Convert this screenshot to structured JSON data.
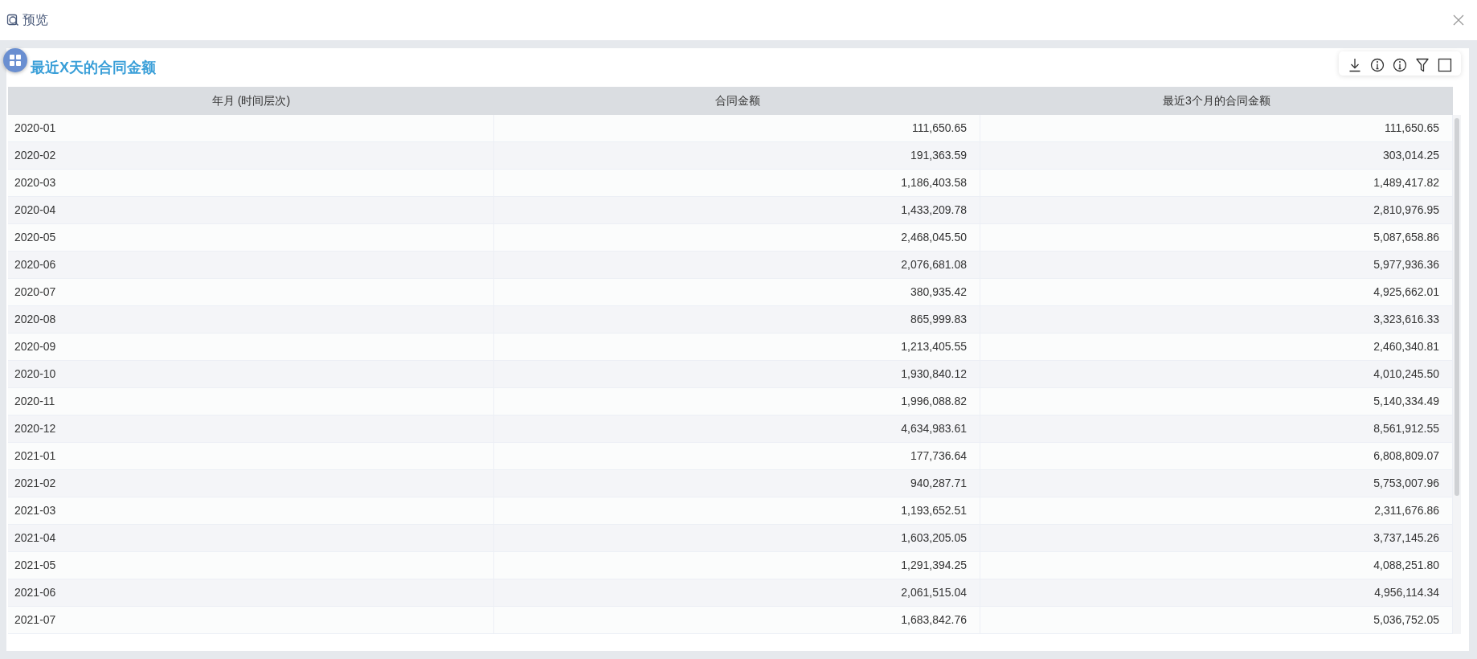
{
  "window": {
    "title": "预览"
  },
  "widget": {
    "title": "最近X天的合同金额"
  },
  "table": {
    "columns": [
      "年月 (时间层次)",
      "合同金额",
      "最近3个月的合同金额"
    ],
    "rows": [
      [
        "2020-01",
        "111,650.65",
        "111,650.65"
      ],
      [
        "2020-02",
        "191,363.59",
        "303,014.25"
      ],
      [
        "2020-03",
        "1,186,403.58",
        "1,489,417.82"
      ],
      [
        "2020-04",
        "1,433,209.78",
        "2,810,976.95"
      ],
      [
        "2020-05",
        "2,468,045.50",
        "5,087,658.86"
      ],
      [
        "2020-06",
        "2,076,681.08",
        "5,977,936.36"
      ],
      [
        "2020-07",
        "380,935.42",
        "4,925,662.01"
      ],
      [
        "2020-08",
        "865,999.83",
        "3,323,616.33"
      ],
      [
        "2020-09",
        "1,213,405.55",
        "2,460,340.81"
      ],
      [
        "2020-10",
        "1,930,840.12",
        "4,010,245.50"
      ],
      [
        "2020-11",
        "1,996,088.82",
        "5,140,334.49"
      ],
      [
        "2020-12",
        "4,634,983.61",
        "8,561,912.55"
      ],
      [
        "2021-01",
        "177,736.64",
        "6,808,809.07"
      ],
      [
        "2021-02",
        "940,287.71",
        "5,753,007.96"
      ],
      [
        "2021-03",
        "1,193,652.51",
        "2,311,676.86"
      ],
      [
        "2021-04",
        "1,603,205.05",
        "3,737,145.26"
      ],
      [
        "2021-05",
        "1,291,394.25",
        "4,088,251.80"
      ],
      [
        "2021-06",
        "2,061,515.04",
        "4,956,114.34"
      ],
      [
        "2021-07",
        "1,683,842.76",
        "5,036,752.05"
      ]
    ]
  }
}
